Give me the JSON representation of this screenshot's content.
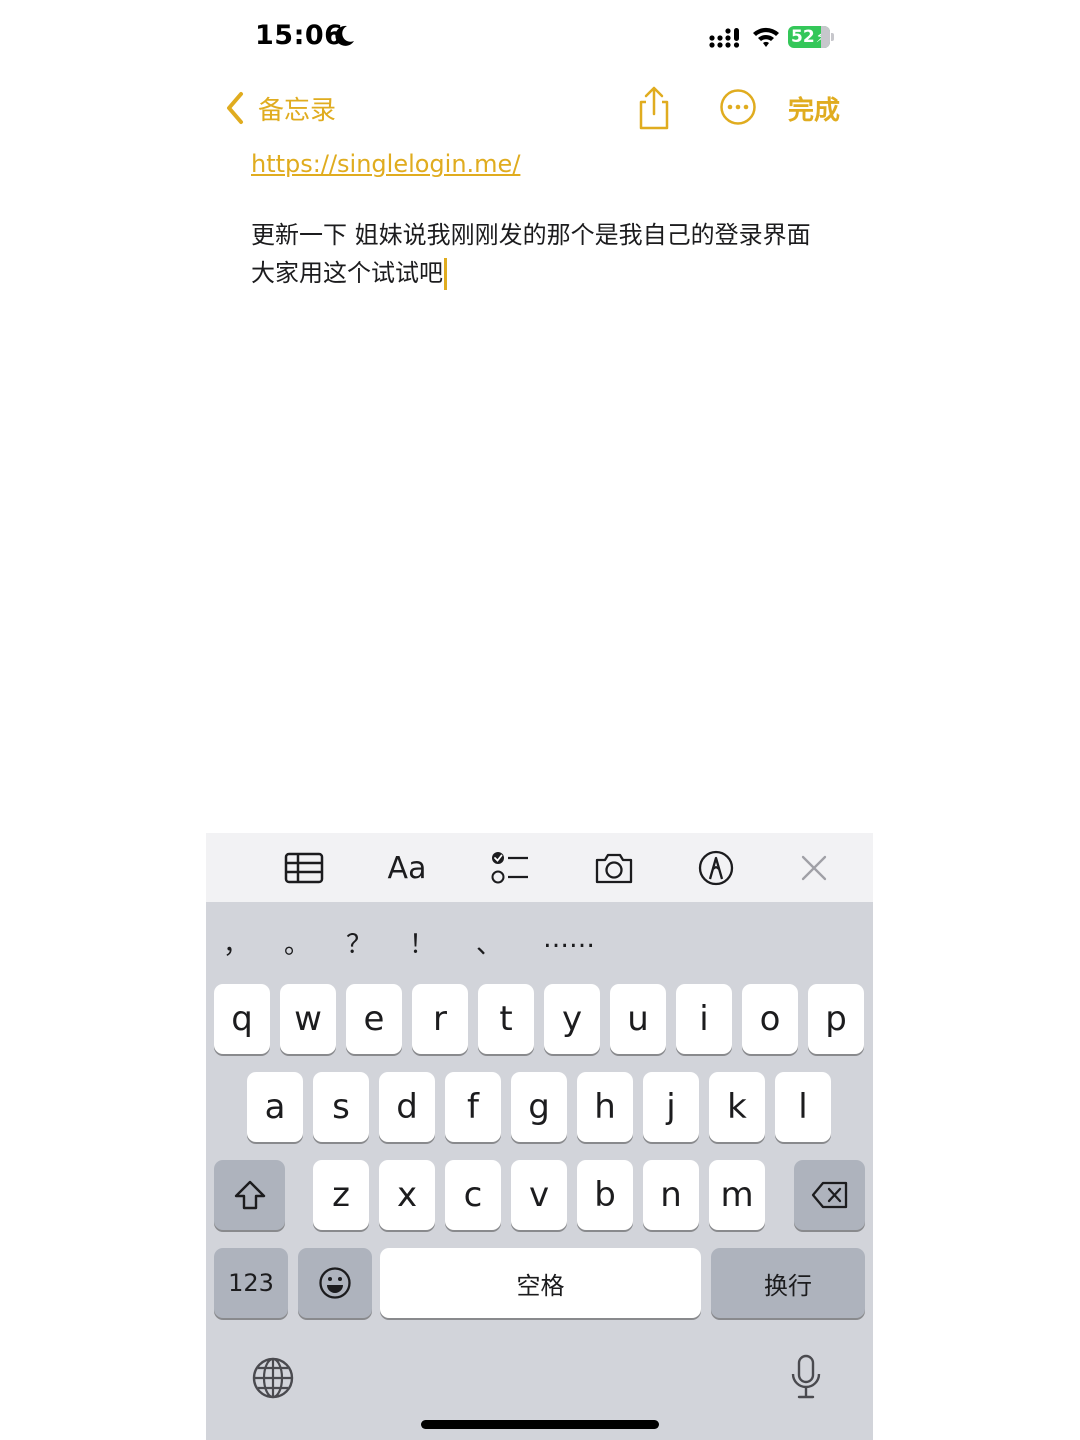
{
  "status_bar": {
    "time": "15:06",
    "battery": "52",
    "moon_icon": "moon-icon",
    "signal_icon": "cellular-signal-icon",
    "wifi_icon": "wifi-icon",
    "battery_color": "#34c759"
  },
  "nav": {
    "back_label": "备忘录",
    "done_label": "完成",
    "accent_color": "#e0ac1f",
    "share_icon": "share-icon",
    "more_icon": "more-ellipsis-icon"
  },
  "note": {
    "link": "https://singlelogin.me/",
    "text": "更新一下 姐妹说我刚刚发的那个是我自己的登录界面 大家用这个试试吧"
  },
  "toolbar": {
    "items": [
      "table-icon",
      "Aa",
      "checklist-icon",
      "camera-icon",
      "markup-pen-icon",
      "close-icon"
    ],
    "format_label": "Aa"
  },
  "keyboard": {
    "candidates": [
      "，",
      "。",
      "？",
      "！",
      "、",
      "……"
    ],
    "row1": [
      "q",
      "w",
      "e",
      "r",
      "t",
      "y",
      "u",
      "i",
      "o",
      "p"
    ],
    "row2": [
      "a",
      "s",
      "d",
      "f",
      "g",
      "h",
      "j",
      "k",
      "l"
    ],
    "row3": [
      "z",
      "x",
      "c",
      "v",
      "b",
      "n",
      "m"
    ],
    "numbers_label": "123",
    "space_label": "空格",
    "return_label": "换行",
    "shift_icon": "shift-icon",
    "delete_icon": "delete-icon",
    "emoji_icon": "emoji-icon",
    "globe_icon": "globe-icon",
    "mic_icon": "microphone-icon"
  }
}
